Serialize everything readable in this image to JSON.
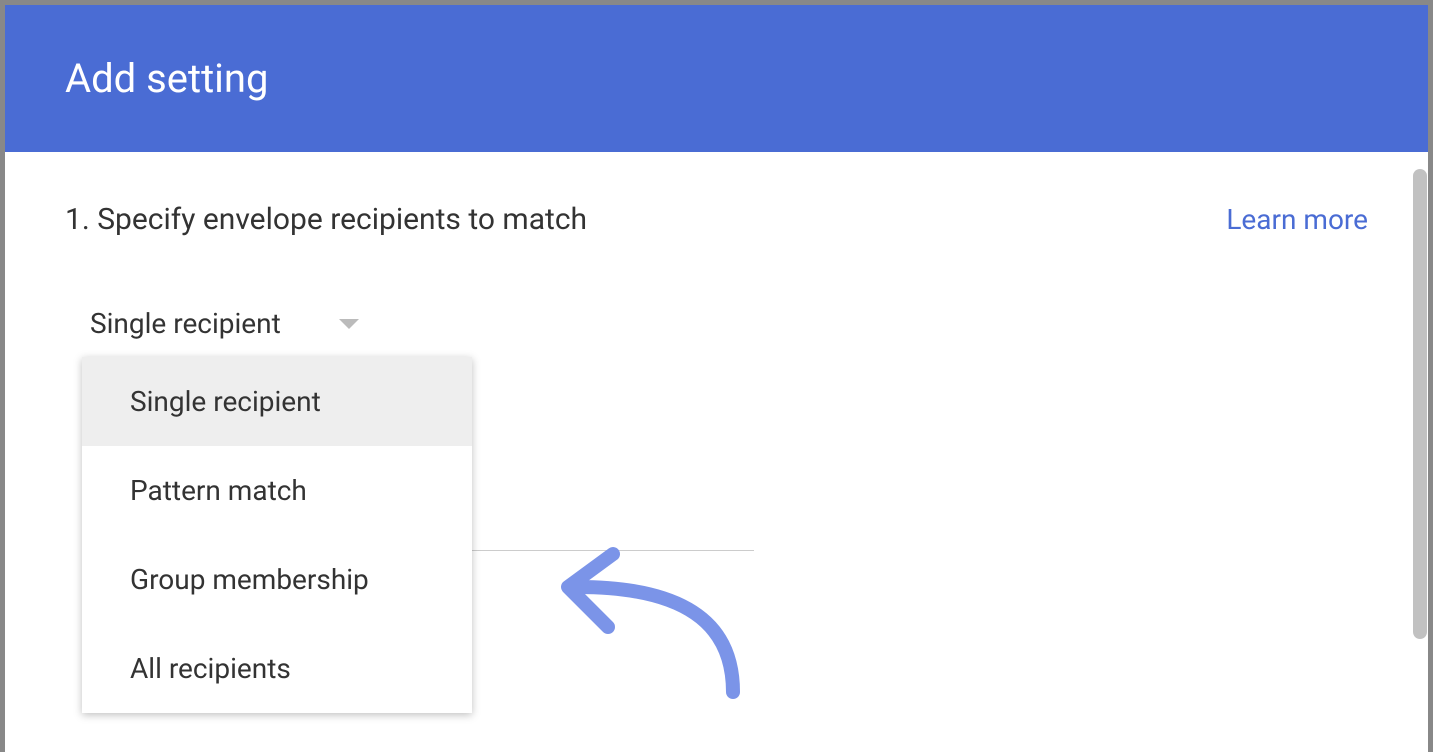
{
  "header": {
    "title": "Add setting"
  },
  "step": {
    "number": "1.",
    "label": "Specify envelope recipients to match",
    "learn_more": "Learn more"
  },
  "dropdown": {
    "selected": "Single recipient",
    "options": [
      "Single recipient",
      "Pattern match",
      "Group membership",
      "All recipients"
    ]
  }
}
